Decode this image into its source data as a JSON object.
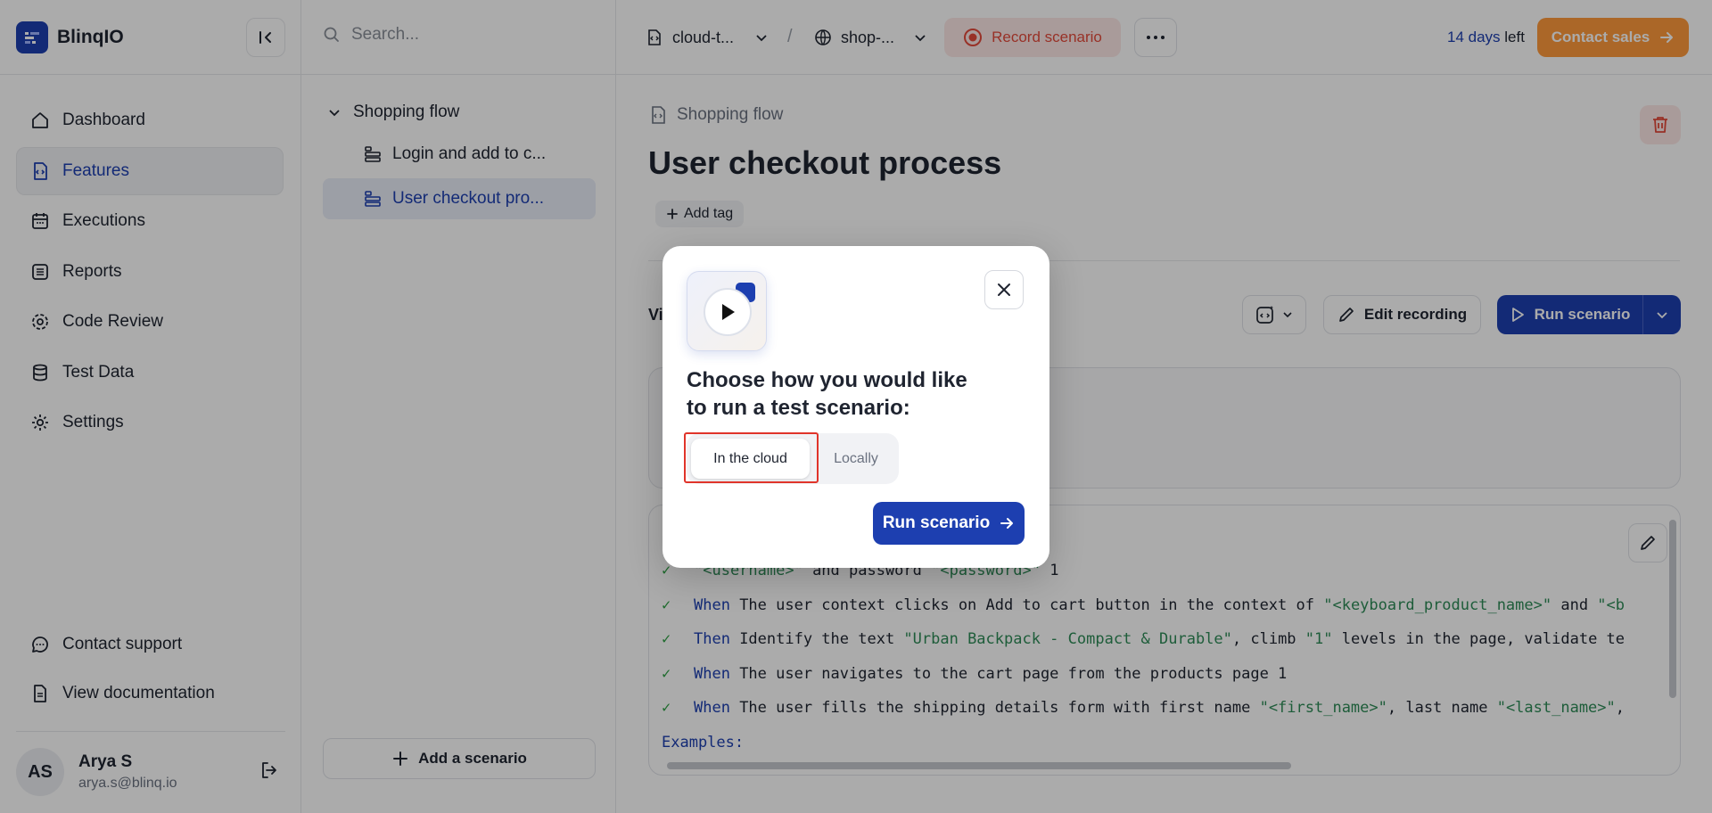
{
  "app": {
    "name": "BlinqIO"
  },
  "sidebar": {
    "items": [
      {
        "label": "Dashboard",
        "icon": "home-icon"
      },
      {
        "label": "Features",
        "icon": "features-icon",
        "active": true
      },
      {
        "label": "Executions",
        "icon": "calendar-icon"
      },
      {
        "label": "Reports",
        "icon": "list-icon"
      },
      {
        "label": "Code Review",
        "icon": "gear-icon"
      },
      {
        "label": "Test Data",
        "icon": "database-icon"
      },
      {
        "label": "Settings",
        "icon": "settings-icon"
      }
    ],
    "bottom": [
      {
        "label": "Contact support",
        "icon": "chat-icon"
      },
      {
        "label": "View documentation",
        "icon": "document-icon"
      }
    ],
    "user": {
      "initials": "AS",
      "name": "Arya S",
      "email": "arya.s@blinq.io"
    }
  },
  "scenarios": {
    "search_placeholder": "Search...",
    "folder": "Shopping flow",
    "items": [
      "Login and add to c...",
      "User checkout pro..."
    ],
    "add_label": "Add a scenario"
  },
  "topbar": {
    "project": "cloud-t...",
    "environment": "shop-...",
    "record_label": "Record scenario",
    "trial_days": "14 days",
    "trial_suffix": " left",
    "contact_label": "Contact sales"
  },
  "main": {
    "feature": "Shopping flow",
    "title": "User checkout process",
    "add_tag": "Add tag",
    "view_label": "Vie",
    "edit_recording": "Edit recording",
    "run_scenario": "Run scenario"
  },
  "code": {
    "lines": [
      {
        "kw": "",
        "parts": [
          [
            "g",
            ""
          ],
          [
            "t",
            "\"<username>\""
          ],
          [
            "p",
            " and password "
          ],
          [
            "t",
            "\"<password>\""
          ],
          [
            "p",
            " 1"
          ]
        ]
      },
      {
        "kw": "When",
        "parts": [
          [
            "p",
            " The user context clicks on Add to cart button in the context of "
          ],
          [
            "t",
            "\"<keyboard_product_name>\""
          ],
          [
            "p",
            " and "
          ],
          [
            "t",
            "\"<b"
          ]
        ]
      },
      {
        "kw": "Then",
        "parts": [
          [
            "p",
            " Identify the text "
          ],
          [
            "t",
            "\"Urban Backpack - Compact & Durable\""
          ],
          [
            "p",
            ", climb "
          ],
          [
            "t",
            "\"1\""
          ],
          [
            "p",
            " levels in the page, validate te"
          ]
        ]
      },
      {
        "kw": "When",
        "parts": [
          [
            "p",
            " The user navigates to the cart page from the products page 1"
          ]
        ]
      },
      {
        "kw": "When",
        "parts": [
          [
            "p",
            " The user fills the shipping details form with first name "
          ],
          [
            "t",
            "\"<first_name>\""
          ],
          [
            "p",
            ", last name "
          ],
          [
            "t",
            "\"<last_name>\""
          ],
          [
            "p",
            ","
          ]
        ]
      }
    ],
    "examples_label": "Examples:"
  },
  "modal": {
    "title": "Choose how you would like to run a test scenario:",
    "option_cloud": "In the cloud",
    "option_local": "Locally",
    "run_label": "Run scenario"
  },
  "colors": {
    "brand": "#1d3fb0",
    "record": "#e34a3b",
    "contact": "#ff9a3c",
    "success": "#2ea043"
  }
}
